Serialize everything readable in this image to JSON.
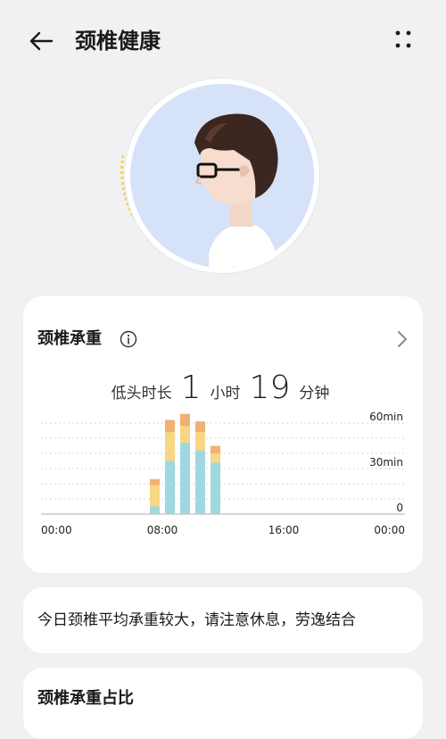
{
  "header": {
    "title": "颈椎健康"
  },
  "card": {
    "title": "颈椎承重",
    "summary_label": "低头时长",
    "hours": "1",
    "hours_unit": "小时",
    "minutes": "19",
    "minutes_unit": "分钟"
  },
  "chart_data": {
    "type": "bar",
    "ylim": [
      0,
      60
    ],
    "y_ticks": [
      "60min",
      "30min",
      "0"
    ],
    "x_ticks": [
      "00:00",
      "08:00",
      "16:00",
      "00:00"
    ],
    "x_tick_hours": [
      0,
      8,
      16,
      24
    ],
    "hours": [
      7.5,
      8.5,
      9.5,
      10.5,
      11.5
    ],
    "series": [
      {
        "values": [
          5,
          35,
          47,
          42,
          34
        ]
      },
      {
        "values": [
          14,
          19,
          11,
          12,
          6
        ]
      },
      {
        "values": [
          4,
          8,
          8,
          7,
          5
        ]
      }
    ],
    "colors": [
      "#9fd8df",
      "#f8d784",
      "#f0b174"
    ]
  },
  "notice": "今日颈椎平均承重较大，请注意休息，劳逸结合",
  "section2": {
    "title": "颈椎承重占比"
  }
}
